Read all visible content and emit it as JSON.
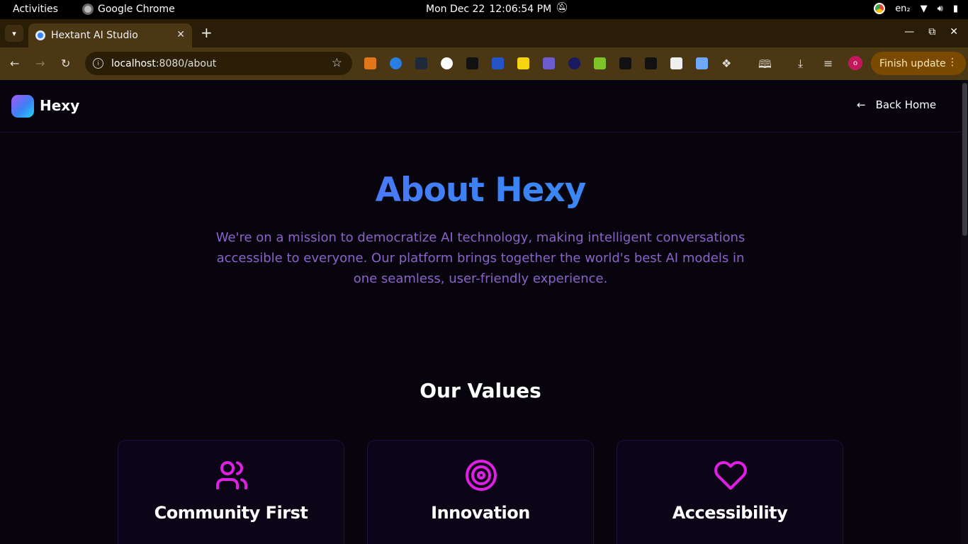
{
  "os": {
    "activities": "Activities",
    "app_name": "Google Chrome",
    "date": "Mon Dec 22",
    "time": "12:06:54 PM",
    "lang": "en₂"
  },
  "browser": {
    "tab_title": "Hextant AI Studio",
    "url_host": "localhost",
    "url_path": ":8080/about",
    "profile_initial": "o",
    "finish_update": "Finish update"
  },
  "site": {
    "logo": "Hexy",
    "back_home": "Back Home",
    "hero_title": "About Hexy",
    "hero_text": "We're on a mission to democratize AI technology, making intelligent conversations accessible to everyone. Our platform brings together the world's best AI models in one seamless, user-friendly experience.",
    "values_title": "Our Values",
    "values": [
      {
        "title": "Community First",
        "icon": "users-icon"
      },
      {
        "title": "Innovation",
        "icon": "target-icon"
      },
      {
        "title": "Accessibility",
        "icon": "heart-icon"
      }
    ],
    "colors": {
      "background": "#07040d",
      "accent_gradient_start": "#7c5cf0",
      "accent_gradient_end": "#3b9cf0",
      "icon_magenta": "#e11ee6",
      "hero_text": "#8a63c9"
    }
  }
}
